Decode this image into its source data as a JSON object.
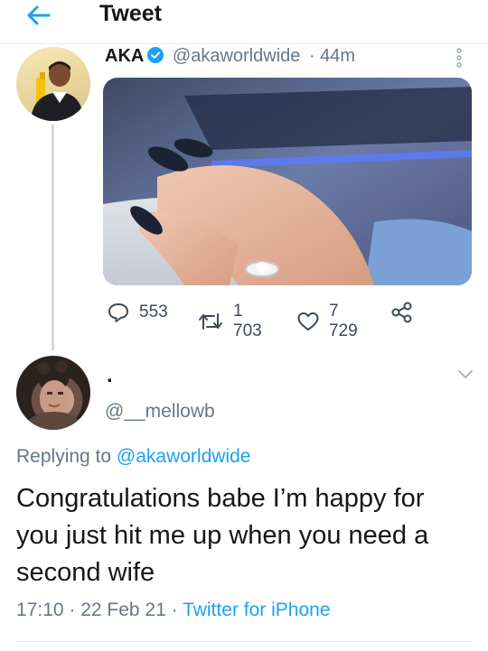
{
  "header": {
    "title": "Tweet",
    "back_icon": "arrow-left-icon"
  },
  "tweet": {
    "name": "AKA",
    "handle": "@akaworldwide",
    "time": "· 44m",
    "image_desc": "hand-with-engagement-ring-photo",
    "actions": {
      "replies": "553",
      "retweets": "1 703",
      "likes": "7 729"
    }
  },
  "reply": {
    "name": ".",
    "handle": "@__mellowb",
    "replying_prefix": "Replying to",
    "replying_to": "@akaworldwide",
    "text": "Congratulations babe I’m happy for you just hit me up when you need a second wife",
    "date": "17:10 · 22 Feb 21 ·",
    "source": "Twitter for iPhone"
  },
  "colors": {
    "accent": "#1da1f2",
    "secondary_text": "#657786",
    "primary_text": "#14171a"
  }
}
